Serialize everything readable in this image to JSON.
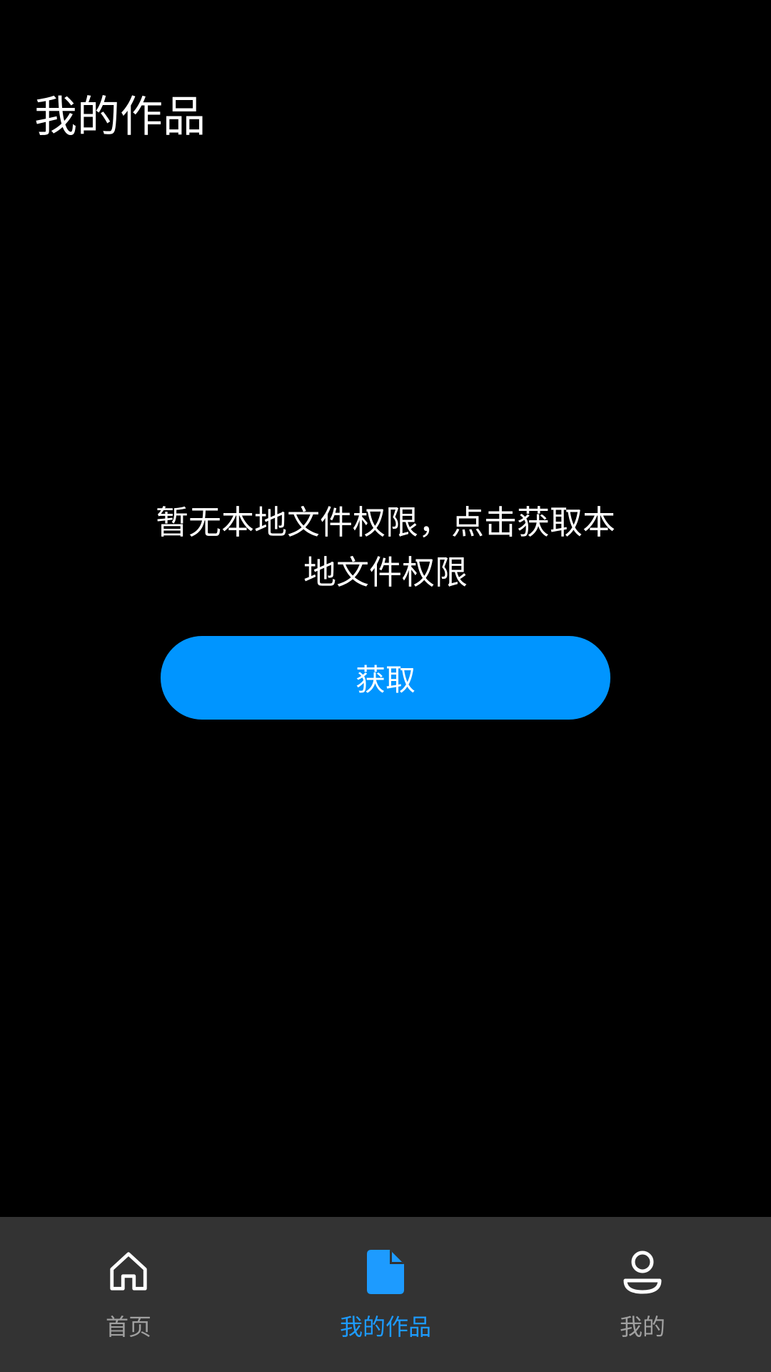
{
  "header": {
    "title": "我的作品"
  },
  "empty_state": {
    "message": "暂无本地文件权限，点击获取本地文件权限",
    "button_label": "获取"
  },
  "tab_bar": {
    "tabs": [
      {
        "label": "首页",
        "icon": "home-icon",
        "active": false
      },
      {
        "label": "我的作品",
        "icon": "document-icon",
        "active": true
      },
      {
        "label": "我的",
        "icon": "person-icon",
        "active": false
      }
    ]
  },
  "colors": {
    "background": "#000000",
    "accent": "#0095ff",
    "tab_bar_background": "#333333",
    "inactive_tab_text": "#a0a0a0",
    "active_tab_text": "#1d9bff"
  }
}
